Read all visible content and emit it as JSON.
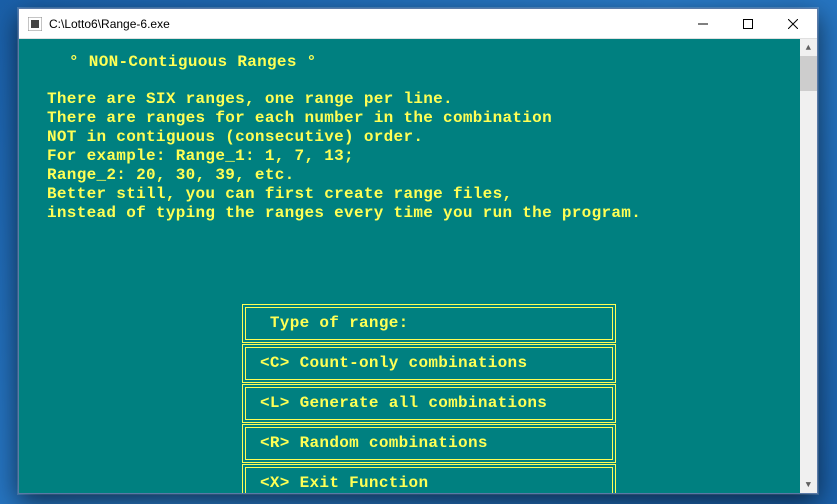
{
  "window": {
    "title": "C:\\Lotto6\\Range-6.exe"
  },
  "console": {
    "heading": "° NON-Contiguous Ranges °",
    "lines": [
      "There are SIX ranges, one range per line.",
      "There are ranges for each number in the combination",
      "NOT in contiguous (consecutive) order.",
      "For example: Range_1: 1, 7, 13;",
      "Range_2: 20, 30, 39, etc.",
      "Better still, you can first create range files,",
      "instead of typing the ranges every time you run the program."
    ],
    "menu": {
      "header": " Type of range:",
      "items": [
        {
          "key": "<C>",
          "label": "Count-only combinations"
        },
        {
          "key": "<L>",
          "label": "Generate all combinations"
        },
        {
          "key": "<R>",
          "label": "Random combinations"
        },
        {
          "key": "<X>",
          "label": "Exit Function"
        }
      ]
    }
  }
}
